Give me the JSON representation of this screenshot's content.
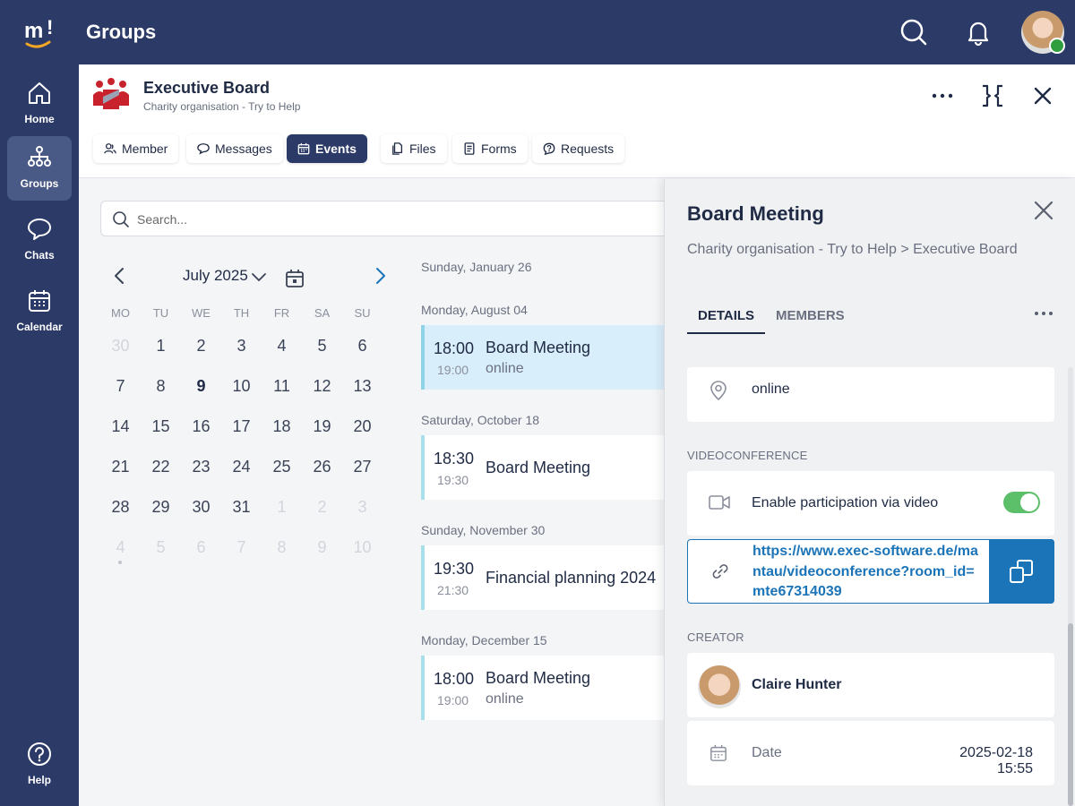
{
  "app": {
    "title": "Groups"
  },
  "sidebar": {
    "items": [
      {
        "label": "Home",
        "icon": "home-icon"
      },
      {
        "label": "Groups",
        "icon": "groups-icon",
        "active": true
      },
      {
        "label": "Chats",
        "icon": "chat-icon"
      },
      {
        "label": "Calendar",
        "icon": "calendar-icon"
      },
      {
        "label": "Help",
        "icon": "help-icon"
      }
    ]
  },
  "header": {
    "group_name": "Executive Board",
    "group_subtitle": "Charity organisation - Try to Help",
    "tabs": [
      {
        "label": "Member",
        "icon": "member-icon"
      },
      {
        "label": "Messages",
        "icon": "message-icon"
      },
      {
        "label": "Events",
        "icon": "calendar-icon",
        "active": true
      },
      {
        "label": "Files",
        "icon": "files-icon"
      },
      {
        "label": "Forms",
        "icon": "forms-icon"
      },
      {
        "label": "Requests",
        "icon": "requests-icon"
      }
    ]
  },
  "search": {
    "placeholder": "Search..."
  },
  "calendar": {
    "month_label": "July 2025",
    "weekdays": [
      "MO",
      "TU",
      "WE",
      "TH",
      "FR",
      "SA",
      "SU"
    ],
    "weeks": [
      [
        "30",
        "1",
        "2",
        "3",
        "4",
        "5",
        "6"
      ],
      [
        "7",
        "8",
        "9",
        "10",
        "11",
        "12",
        "13"
      ],
      [
        "14",
        "15",
        "16",
        "17",
        "18",
        "19",
        "20"
      ],
      [
        "21",
        "22",
        "23",
        "24",
        "25",
        "26",
        "27"
      ],
      [
        "28",
        "29",
        "30",
        "31",
        "1",
        "2",
        "3"
      ],
      [
        "4",
        "5",
        "6",
        "7",
        "8",
        "9",
        "10"
      ]
    ],
    "today": "9"
  },
  "events": {
    "first_date": "Sunday, January 26",
    "groups": [
      {
        "date": "Monday, August 04",
        "start": "18:00",
        "end": "19:00",
        "title": "Board Meeting",
        "location": "online",
        "selected": true
      },
      {
        "date": "Saturday, October 18",
        "start": "18:30",
        "end": "19:30",
        "title": "Board Meeting",
        "location": ""
      },
      {
        "date": "Sunday, November 30",
        "start": "19:30",
        "end": "21:30",
        "title": "Financial planning 2024",
        "location": ""
      },
      {
        "date": "Monday, December 15",
        "start": "18:00",
        "end": "19:00",
        "title": "Board Meeting",
        "location": "online"
      }
    ]
  },
  "detail": {
    "title": "Board Meeting",
    "breadcrumb": "Charity organisation - Try to Help > Executive Board",
    "tabs": {
      "details": "DETAILS",
      "members": "MEMBERS"
    },
    "location": "online",
    "video_section": "VIDEOCONFERENCE",
    "video_toggle_label": "Enable participation via video",
    "video_enabled": true,
    "video_link": "https://www.exec-software.de/mantau/videoconference?room_id=mte67314039",
    "creator_section": "CREATOR",
    "creator_name": "Claire Hunter",
    "date_label": "Date",
    "date_value": "2025-02-18 15:55"
  },
  "colors": {
    "primary": "#2b3a67",
    "link": "#1c74b8",
    "toggle_on": "#5cbf6a",
    "event_accent": "#a8dfe8"
  }
}
